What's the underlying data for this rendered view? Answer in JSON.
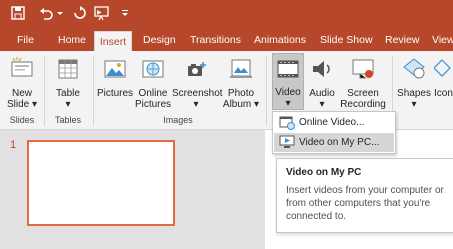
{
  "colors": {
    "accent": "#b7472a",
    "ribbon": "#f3f3f3",
    "selection_border": "#e26b3f"
  },
  "qat": {
    "save_icon": "save-icon",
    "undo_icon": "undo-icon",
    "redo_icon": "redo-icon",
    "customize_icon": "customize-qat-icon"
  },
  "tabs": [
    {
      "label": "File"
    },
    {
      "label": "Home"
    },
    {
      "label": "Insert"
    },
    {
      "label": "Design"
    },
    {
      "label": "Transitions"
    },
    {
      "label": "Animations"
    },
    {
      "label": "Slide Show"
    },
    {
      "label": "Review"
    },
    {
      "label": "View"
    }
  ],
  "ribbon": {
    "slides": {
      "line1": "New",
      "line2": "Slide",
      "group": "Slides"
    },
    "tables": {
      "line1": "Table",
      "group": "Tables"
    },
    "images": {
      "pictures": "Pictures",
      "online_pictures_1": "Online",
      "online_pictures_2": "Pictures",
      "screenshot": "Screenshot",
      "photo_album_1": "Photo",
      "photo_album_2": "Album",
      "group": "Images"
    },
    "media": {
      "video": "Video",
      "audio": "Audio",
      "screen_rec_1": "Screen",
      "screen_rec_2": "Recording"
    },
    "illustrations": {
      "shapes": "Shapes",
      "icons": "Icons"
    }
  },
  "slides_panel": {
    "number": "1"
  },
  "dropdown": {
    "online_video": "Online Video...",
    "video_on_pc": "Video on My PC..."
  },
  "tooltip": {
    "title": "Video on My PC",
    "description": "Insert videos from your computer or from other computers that you're connected to."
  }
}
